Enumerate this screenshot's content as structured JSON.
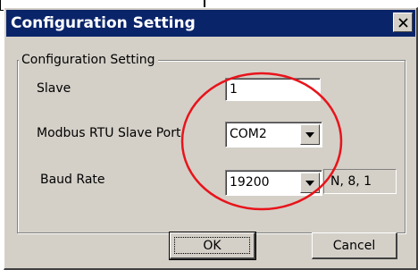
{
  "dialog": {
    "title": "Configuration Setting",
    "close_icon": "close-x-icon"
  },
  "group": {
    "legend": "Configuration Setting"
  },
  "fields": {
    "slave": {
      "label": "Slave",
      "value": "1"
    },
    "port": {
      "label": "Modbus RTU Slave Port",
      "selected": "COM2",
      "icon": "dropdown-arrow-icon"
    },
    "baud": {
      "label": "Baud Rate",
      "selected": "19200",
      "icon": "dropdown-arrow-icon",
      "format": "N, 8, 1"
    }
  },
  "buttons": {
    "ok": "OK",
    "cancel": "Cancel"
  },
  "annotation": {
    "shape": "ellipse",
    "color": "#e8141b"
  },
  "colors": {
    "titlebar": "#0a246a",
    "face": "#d4d0c8"
  }
}
